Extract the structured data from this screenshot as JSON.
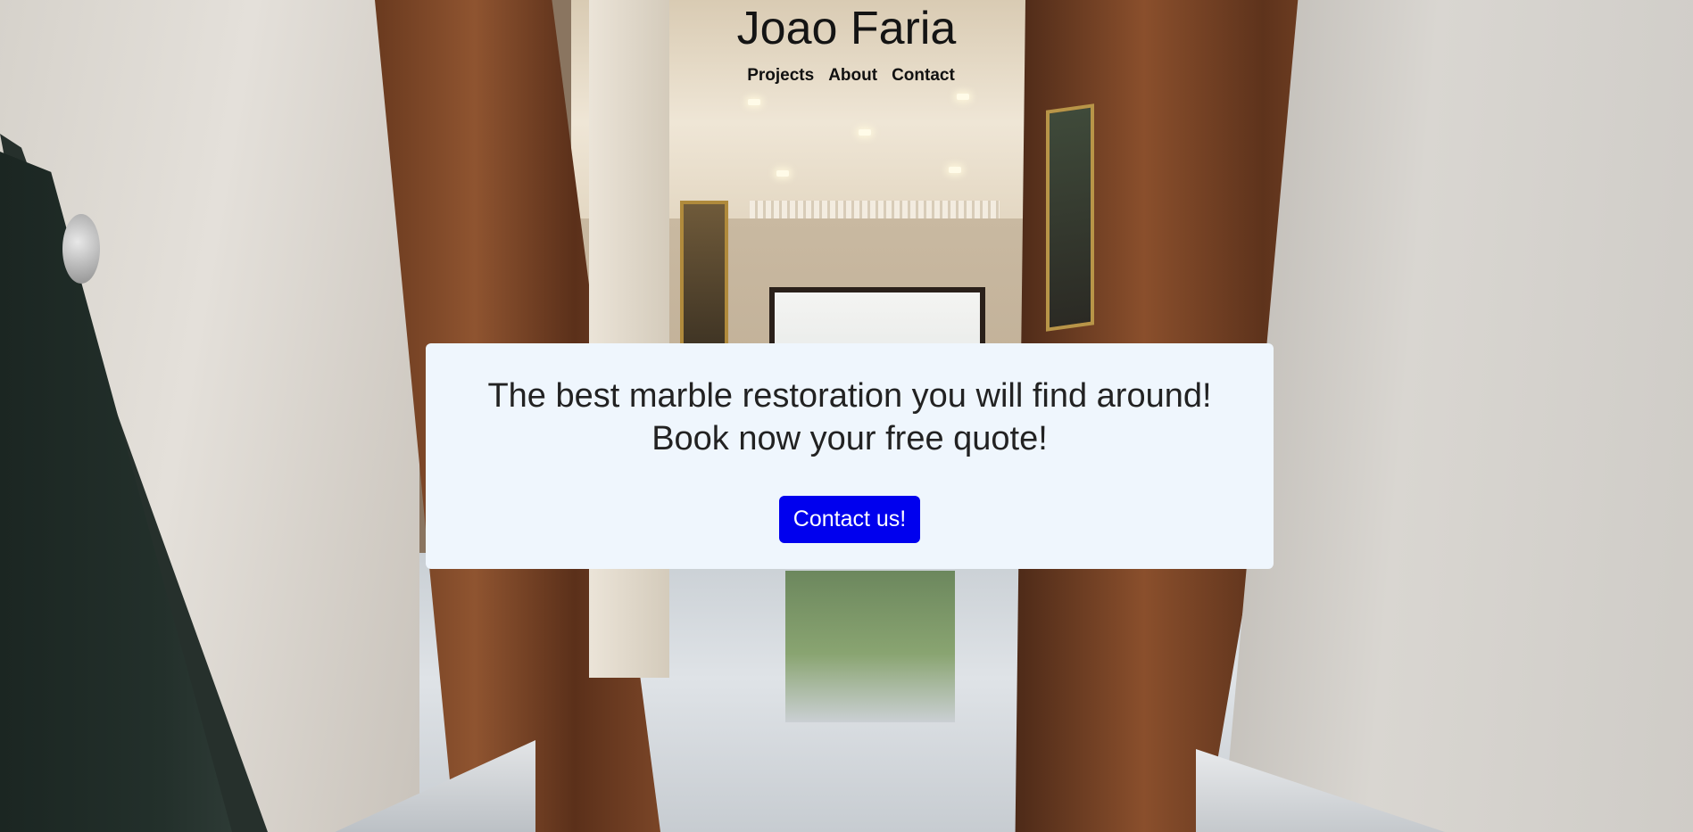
{
  "site": {
    "title": "Joao Faria"
  },
  "nav": {
    "items": [
      {
        "label": "Projects"
      },
      {
        "label": "About"
      },
      {
        "label": "Contact"
      }
    ]
  },
  "hero": {
    "line1": "The best marble restoration you will find around!",
    "line2": "Book now your free quote!",
    "cta_label": "Contact us!"
  },
  "colors": {
    "card_background": "#eff6fd",
    "cta_background": "#0000ee",
    "cta_text": "#ffffff",
    "title_text": "#141414"
  },
  "background_image": {
    "icon": "hallway-photo"
  }
}
